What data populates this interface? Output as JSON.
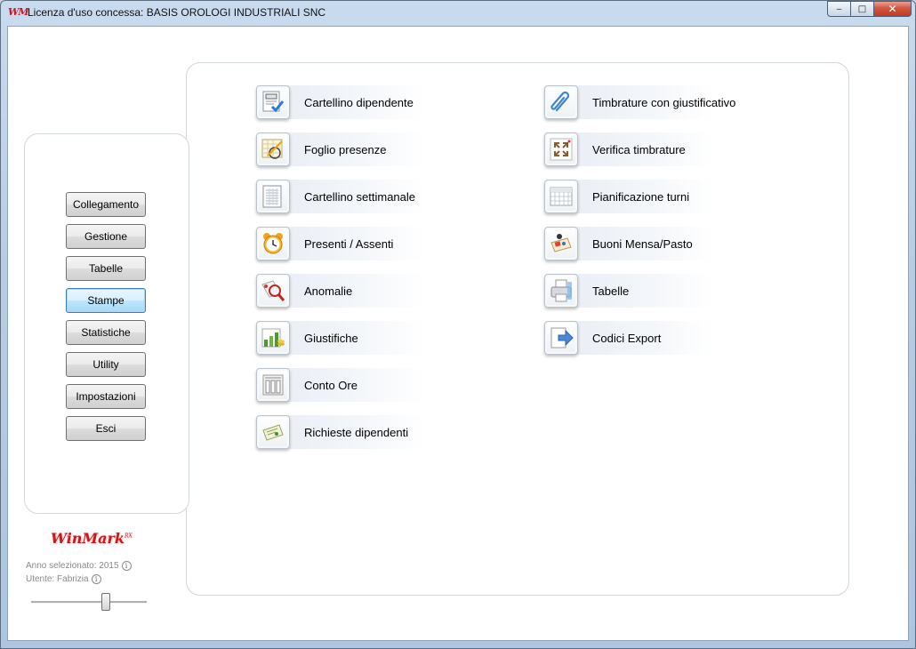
{
  "window": {
    "icon_text": "WM",
    "title": "Licenza d'uso concessa: BASIS OROLOGI INDUSTRIALI SNC",
    "controls": {
      "minimize": "‒",
      "maximize": "□",
      "close": "✕"
    }
  },
  "sidebar": {
    "buttons": [
      {
        "label": "Collegamento"
      },
      {
        "label": "Gestione"
      },
      {
        "label": "Tabelle"
      },
      {
        "label": "Stampe",
        "active": true
      },
      {
        "label": "Statistiche"
      },
      {
        "label": "Utility"
      },
      {
        "label": "Impostazioni"
      },
      {
        "label": "Esci"
      }
    ],
    "logo": {
      "text": "WinMark",
      "superscript": "RX"
    },
    "year_info": "Anno selezionato: 2015",
    "user_info": "Utente: Fabrizia",
    "info_glyph": "i",
    "slider_level": 0.66
  },
  "menu": {
    "left": [
      {
        "label": "Cartellino dipendente",
        "icon": "employee-card-icon"
      },
      {
        "label": "Foglio presenze",
        "icon": "attendance-sheet-icon"
      },
      {
        "label": "Cartellino settimanale",
        "icon": "weekly-card-icon"
      },
      {
        "label": "Presenti / Assenti",
        "icon": "alarm-clock-icon"
      },
      {
        "label": "Anomalie",
        "icon": "magnifier-icon"
      },
      {
        "label": "Giustifiche",
        "icon": "chart-coins-icon"
      },
      {
        "label": "Conto Ore",
        "icon": "hours-account-icon"
      },
      {
        "label": "Richieste dipendenti",
        "icon": "request-ticket-icon"
      }
    ],
    "right": [
      {
        "label": "Timbrature con giustificativo",
        "icon": "paperclip-icon"
      },
      {
        "label": "Verifica timbrature",
        "icon": "verify-arrows-icon"
      },
      {
        "label": "Pianificazione turni",
        "icon": "shift-grid-icon"
      },
      {
        "label": "Buoni Mensa/Pasto",
        "icon": "meal-voucher-icon"
      },
      {
        "label": "Tabelle",
        "icon": "printer-icon"
      },
      {
        "label": "Codici Export",
        "icon": "export-arrow-icon"
      }
    ]
  }
}
